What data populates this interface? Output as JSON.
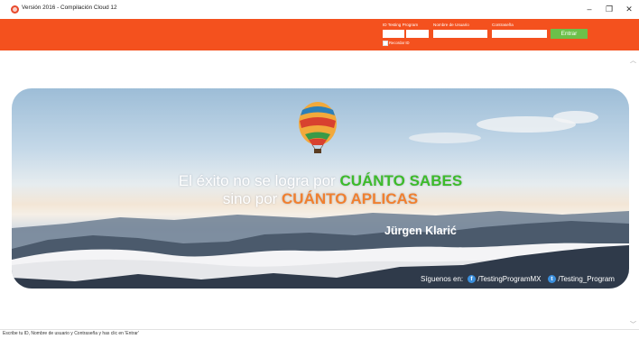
{
  "window": {
    "title": "Versión 2016 - Compilación Cloud 12",
    "minimize": "–",
    "maximize": "❐",
    "close": "✕"
  },
  "login": {
    "id_label": "ID Testing Program",
    "username_label": "Nombre de Usuario",
    "password_label": "Contraseña",
    "id_value": "",
    "username_value": "",
    "password_value": "",
    "remember_label": "Recordar ID",
    "enter_label": "Entrar"
  },
  "banner": {
    "line1_prefix": "El éxito no se logra por ",
    "line1_highlight": "CUÁNTO SABES",
    "line2_prefix": "sino por ",
    "line2_highlight": "CUÁNTO APLICAS",
    "author": "Jürgen Klarić",
    "follow_label": "Síguenos en:",
    "facebook_icon": "f",
    "facebook_handle": "/TestingProgramMX",
    "twitter_icon": "t",
    "twitter_handle": "/Testing_Program",
    "colors": {
      "green": "#3dbb2b",
      "orange": "#f08030"
    }
  },
  "status": {
    "text": "Escribe tu ID, Nombre de usuario y Contraseña y has clic en 'Entrar'"
  },
  "theme": {
    "header": "#f4511e",
    "button": "#6cc04a"
  }
}
